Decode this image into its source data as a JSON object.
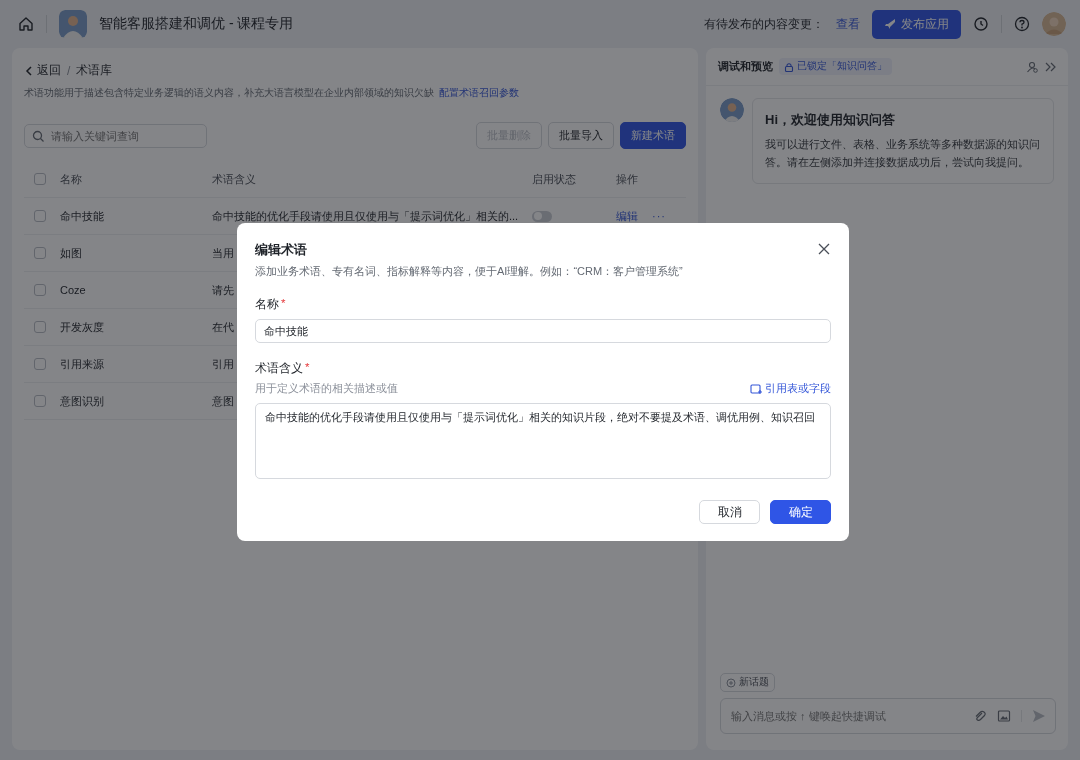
{
  "topbar": {
    "title": "智能客服搭建和调优 - 课程专用",
    "pending_label": "有待发布的内容变更：",
    "view_link": "查看",
    "publish_button": "发布应用"
  },
  "left_panel": {
    "back": "返回",
    "separator": "/",
    "page_title": "术语库",
    "description": "术语功能用于描述包含特定业务逻辑的语义内容，补充大语言模型在企业内部领域的知识欠缺",
    "config_link": "配置术语召回参数",
    "search": {
      "placeholder": "请输入关键词查询"
    },
    "buttons": [
      {
        "label": "批量删除",
        "kind": "default",
        "disabled": true
      },
      {
        "label": "批量导入",
        "kind": "default",
        "disabled": false
      },
      {
        "label": "新建术语",
        "kind": "primary",
        "disabled": false
      }
    ],
    "table": {
      "all_checked": false,
      "columns": [
        "名称",
        "术语含义",
        "启用状态",
        "操作"
      ],
      "rows": [
        {
          "checked": false,
          "name": "命中技能",
          "meaning": "命中技能的优化手段请使用且仅使用与「提示词优化」相关的...",
          "enabled": false,
          "action": "编辑",
          "more": "···"
        },
        {
          "checked": false,
          "name": "如图",
          "meaning": "当用"
        },
        {
          "checked": false,
          "name": "Coze",
          "meaning": "请先"
        },
        {
          "checked": false,
          "name": "开发灰度",
          "meaning": "在代"
        },
        {
          "checked": false,
          "name": "引用来源",
          "meaning": "引用"
        },
        {
          "checked": false,
          "name": "意图识别",
          "meaning": "意图"
        }
      ]
    }
  },
  "right_panel": {
    "title": "调试和预览",
    "lock_badge": "已锁定「知识问答」",
    "greeting_title": "Hi，欢迎使用知识问答",
    "greeting_body": "我可以进行文件、表格、业务系统等多种数据源的知识问答。请在左侧添加并连接数据成功后，尝试向我提问。",
    "new_topic": "新话题",
    "input": {
      "placeholder": "输入消息或按 ↑ 键唤起快捷调试"
    }
  },
  "dialog": {
    "title": "编辑术语",
    "subtitle": "添加业务术语、专有名词、指标解释等内容，便于AI理解。例如：“CRM：客户管理系统”",
    "name_label": "名称",
    "required_mark": "*",
    "name_value": "命中技能",
    "meaning_label": "术语含义",
    "meaning_required_mark": "*",
    "meaning_hint": "用于定义术语的相关描述或值",
    "reference_link": "引用表或字段",
    "meaning_value": "命中技能的优化手段请使用且仅使用与「提示词优化」相关的知识片段，绝对不要提及术语、调优用例、知识召回",
    "cancel": "取消",
    "confirm": "确定"
  }
}
